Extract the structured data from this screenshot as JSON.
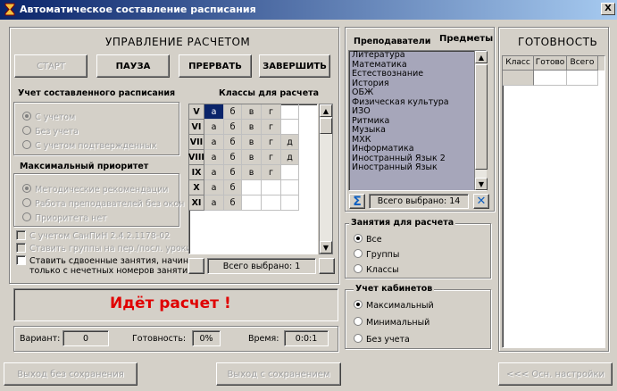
{
  "window": {
    "title": "Автоматическое составление расписания",
    "close_label": "X"
  },
  "control": {
    "heading": "УПРАВЛЕНИЕ РАСЧЕТОМ",
    "start_label": "СТАРТ",
    "pause_label": "ПАУЗА",
    "abort_label": "ПРЕРВАТЬ",
    "finish_label": "ЗАВЕРШИТЬ"
  },
  "accounting": {
    "heading": "Учет составленного расписания",
    "options": [
      "С учетом",
      "Без учета",
      "С учетом подтвержденных"
    ],
    "selected": 0
  },
  "priority": {
    "heading": "Максимальный приоритет",
    "options": [
      "Методические рекомендации",
      "Работа преподавателей без окон",
      "Приоритета нет"
    ],
    "selected": 0
  },
  "checkboxes": {
    "sanpin": "С учетом СанПиН 2.4.2.1178-02",
    "groups": "Ставить группы на пер./посл. уроки",
    "paired_line1": "Ставить сдвоенные занятия, начиная",
    "paired_line2": "только с нечетных номеров занятий"
  },
  "classes": {
    "heading": "Классы для расчета",
    "rows": [
      {
        "grade": "V",
        "letters": [
          "а",
          "б",
          "в",
          "г",
          ""
        ]
      },
      {
        "grade": "VI",
        "letters": [
          "а",
          "б",
          "в",
          "г",
          ""
        ]
      },
      {
        "grade": "VII",
        "letters": [
          "а",
          "б",
          "в",
          "г",
          "д"
        ]
      },
      {
        "grade": "VIII",
        "letters": [
          "а",
          "б",
          "в",
          "г",
          "д"
        ]
      },
      {
        "grade": "IX",
        "letters": [
          "а",
          "б",
          "в",
          "г",
          ""
        ]
      },
      {
        "grade": "X",
        "letters": [
          "а",
          "б",
          "",
          "",
          ""
        ]
      },
      {
        "grade": "XI",
        "letters": [
          "а",
          "б",
          "",
          "",
          ""
        ]
      }
    ],
    "total_label": "Всего выбрано: 1"
  },
  "status": {
    "message": "Идёт расчет !",
    "variant_label": "Вариант:",
    "variant_value": "0",
    "ready_label": "Готовность:",
    "ready_value": "0%",
    "time_label": "Время:",
    "time_value": "0:0:1",
    "message_color": "#e00000"
  },
  "subjects": {
    "tab_teachers": "Преподаватели",
    "tab_subjects": "Предметы",
    "items": [
      "Литература",
      "Математика",
      "Естествознание",
      "История",
      "ОБЖ",
      "Физическая культура",
      "ИЗО",
      "Ритмика",
      "Музыка",
      "МХК",
      "Информатика",
      "Иностранный Язык 2",
      "Иностранный Язык"
    ],
    "total_label": "Всего выбрано:",
    "total_value": "14"
  },
  "lessons": {
    "heading": "Занятия для расчета",
    "options": [
      "Все",
      "Группы",
      "Классы"
    ],
    "selected": 0
  },
  "rooms": {
    "heading": "Учет кабинетов",
    "options": [
      "Максимальный",
      "Минимальный",
      "Без учета"
    ],
    "selected": 0
  },
  "readiness": {
    "heading": "ГОТОВНОСТЬ",
    "columns": [
      "Класс",
      "Готово",
      "Всего"
    ]
  },
  "footer": {
    "exit_no_save": "Выход без сохранения",
    "exit_save": "Выход с сохранением",
    "main_settings": "<<< Осн. настройки"
  }
}
